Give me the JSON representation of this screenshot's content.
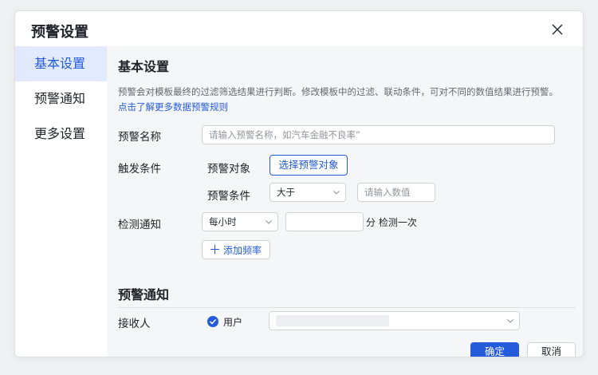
{
  "dialog": {
    "title": "预警设置"
  },
  "sidebar": {
    "items": [
      {
        "label": "基本设置",
        "active": true
      },
      {
        "label": "预警通知",
        "active": false
      },
      {
        "label": "更多设置",
        "active": false
      }
    ]
  },
  "basic": {
    "section_title": "基本设置",
    "description": "预警会对模板最终的过滤筛选结果进行判断。修改模板中的过滤、联动条件，可对不同的数值结果进行预警。",
    "rule_link": "点击了解更多数据预警规则",
    "name_label": "预警名称",
    "name_placeholder": "请输入预警名称，如汽车金融不良率”",
    "trigger_label": "触发条件",
    "target_label": "预警对象",
    "target_button": "选择预警对象",
    "condition_label": "预警条件",
    "condition_value": "大于",
    "condition_input_placeholder": "请输入数值",
    "detect_label": "检测通知",
    "detect_frequency": "每小时",
    "detect_unit": "分 检测一次",
    "add_frequency": "添加频率"
  },
  "notify": {
    "section_title": "预警通知",
    "receiver_label": "接收人",
    "receiver_type": "用户"
  },
  "footer": {
    "confirm": "确定",
    "cancel": "取消"
  },
  "colors": {
    "accent": "#245bdb",
    "active_bg": "#e1eaff",
    "content_bg": "#f5f6f7"
  },
  "icons": {
    "close": "close-icon",
    "chevron": "chevron-down-icon",
    "plus": "plus-icon",
    "check": "check-icon"
  }
}
